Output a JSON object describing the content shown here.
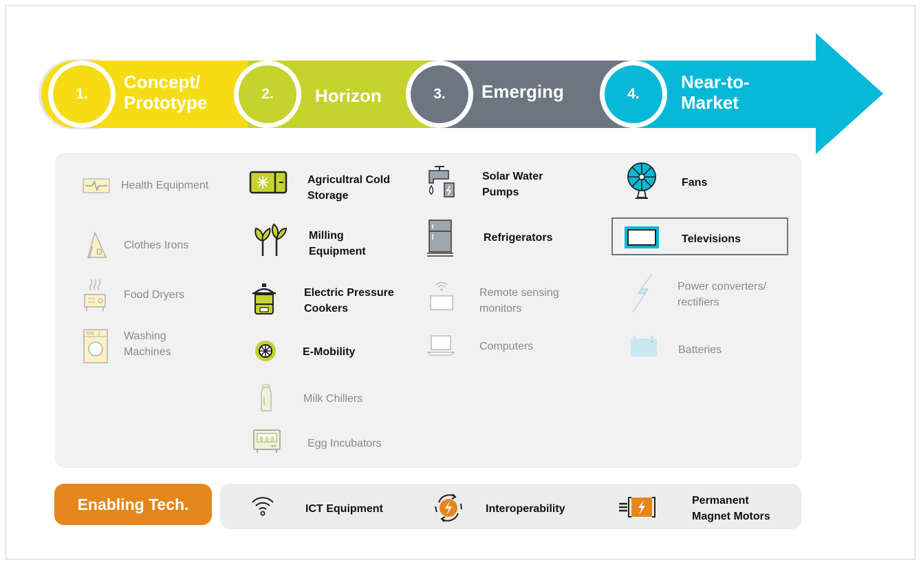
{
  "stages": [
    {
      "num": "1.",
      "title_line1": "Concept/",
      "title_line2": "Prototype",
      "color": "#f6dc14"
    },
    {
      "num": "2.",
      "title_line1": "Horizon",
      "color": "#c6d22d"
    },
    {
      "num": "3.",
      "title_line1": "Emerging",
      "color": "#6c7680"
    },
    {
      "num": "4.",
      "title_line1": "Near-to-",
      "title_line2": "Market",
      "color": "#08b8d8"
    }
  ],
  "columns": {
    "concept": [
      {
        "label": "Health Equipment",
        "icon": "health-monitor-icon"
      },
      {
        "label": "Clothes Irons",
        "icon": "iron-icon"
      },
      {
        "label": "Food Dryers",
        "icon": "food-dryer-icon"
      },
      {
        "label1": "Washing",
        "label2": "Machines",
        "icon": "washing-machine-icon"
      }
    ],
    "horizon": [
      {
        "label1": "Agricultral Cold",
        "label2": "Storage",
        "icon": "cold-storage-icon"
      },
      {
        "label1": "Milling",
        "label2": "Equipment",
        "icon": "plant-icon"
      },
      {
        "label1": "Electric Pressure",
        "label2": "Cookers",
        "icon": "pressure-cooker-icon"
      },
      {
        "label": "E-Mobility",
        "icon": "wheel-icon"
      },
      {
        "label": "Milk Chillers",
        "icon": "milk-bottle-icon"
      },
      {
        "label": "Egg Incubators",
        "icon": "egg-incubator-icon"
      }
    ],
    "emerging": [
      {
        "label1": "Solar Water",
        "label2": "Pumps",
        "icon": "water-pump-icon"
      },
      {
        "label": "Refrigerators",
        "icon": "refrigerator-icon"
      },
      {
        "label1": "Remote sensing",
        "label2": "monitors",
        "icon": "remote-sensor-icon"
      },
      {
        "label": "Computers",
        "icon": "laptop-icon"
      }
    ],
    "market": [
      {
        "label": "Fans",
        "icon": "fan-icon"
      },
      {
        "label": "Televisions",
        "icon": "television-icon"
      },
      {
        "label1": "Power converters/",
        "label2": "rectifiers",
        "icon": "lightning-icon"
      },
      {
        "label": "Batteries",
        "icon": "battery-icon"
      }
    ]
  },
  "enabling": {
    "title": "Enabling Tech.",
    "items": [
      {
        "label": "ICT Equipment",
        "icon": "wifi-icon"
      },
      {
        "label": "Interoperability",
        "icon": "interoperability-icon"
      },
      {
        "label1": "Permanent",
        "label2": "Magnet Motors",
        "icon": "motor-icon"
      }
    ]
  },
  "colors": {
    "yellow": "#f6dc14",
    "lime": "#c6d22d",
    "slate": "#6c7680",
    "cyan": "#08b8d8",
    "orange": "#e5861c"
  }
}
